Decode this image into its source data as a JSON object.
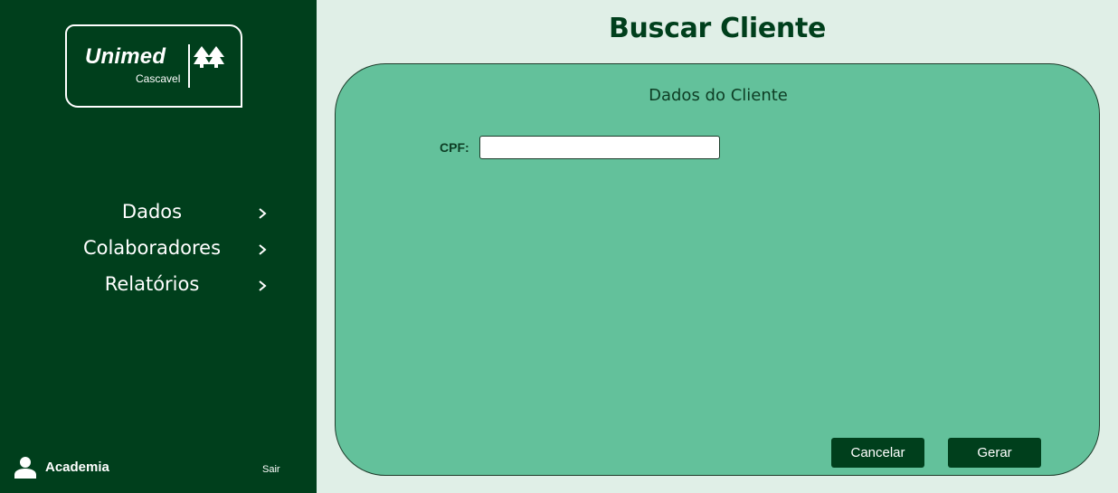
{
  "sidebar": {
    "logo": {
      "brand": "Unimed",
      "city": "Cascavel",
      "icon": "unimed-trees-icon"
    },
    "nav": [
      {
        "label": "Dados",
        "icon": "chevron-right-icon"
      },
      {
        "label": "Colaboradores",
        "icon": "chevron-right-icon"
      },
      {
        "label": "Relatórios",
        "icon": "chevron-right-icon"
      }
    ],
    "user": {
      "name": "Academia",
      "icon": "user-icon"
    },
    "logout_label": "Sair"
  },
  "main": {
    "title": "Buscar Cliente",
    "card": {
      "title": "Dados do Cliente",
      "cpf_label": "CPF:",
      "cpf_value": "",
      "cancel_label": "Cancelar",
      "submit_label": "Gerar"
    }
  },
  "colors": {
    "sidebar_bg": "#003f1c",
    "page_bg": "#e0efe7",
    "card_bg": "#63c19b",
    "button_bg": "#003f1c",
    "title_color": "#003f1c"
  }
}
